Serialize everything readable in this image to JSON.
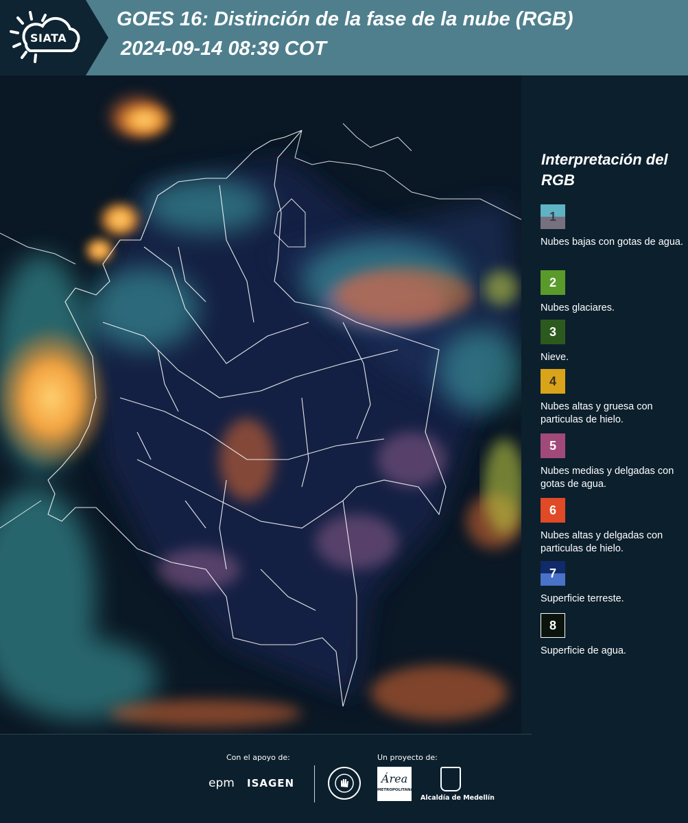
{
  "header": {
    "logo_text": "SIATA",
    "title_line1": "GOES 16: Distinción de la fase de la nube (RGB)",
    "title_line2": "2024-09-14 08:39 COT"
  },
  "legend": {
    "title": "Interpretación del RGB",
    "items": [
      {
        "number": "1",
        "label": "Nubes bajas con gotas de agua.",
        "color_top": "#5fb3c2",
        "color_bottom": "#76707f"
      },
      {
        "number": "2",
        "label": "Nubes glaciares.",
        "color_top": "#5a9a2a",
        "color_bottom": "#5a9a2a"
      },
      {
        "number": "3",
        "label": "Nieve.",
        "color_top": "#2c5a1e",
        "color_bottom": "#2c5a1e"
      },
      {
        "number": "4",
        "label": "Nubes altas y gruesa con particulas de hielo.",
        "color_top": "#d9a31a",
        "color_bottom": "#d9a31a"
      },
      {
        "number": "5",
        "label": "Nubes medias y delgadas con gotas de agua.",
        "color_top": "#a14a7a",
        "color_bottom": "#a14a7a"
      },
      {
        "number": "6",
        "label": "Nubes altas y delgadas con particulas de hielo.",
        "color_top": "#e04a26",
        "color_bottom": "#e04a26"
      },
      {
        "number": "7",
        "label": "Superficie terreste.",
        "color_top": "#102a6a",
        "color_bottom": "#4a72c8"
      },
      {
        "number": "8",
        "label": "Superficie de agua.",
        "color_top": "#0a140c",
        "color_bottom": "#0a140c"
      }
    ]
  },
  "footer": {
    "support_label": "Con el apoyo de:",
    "project_label": "Un proyecto de:",
    "sponsor1": "epm",
    "sponsor2": "ISAGEN",
    "area_logo_text": "Área",
    "area_logo_sub": "METROPOLITANA",
    "alcaldia": "Alcaldía de Medellín"
  },
  "colors": {
    "header_bg": "#4f7f8d",
    "panel_bg": "#0c1f2d",
    "map_bg": "#0a1420"
  }
}
